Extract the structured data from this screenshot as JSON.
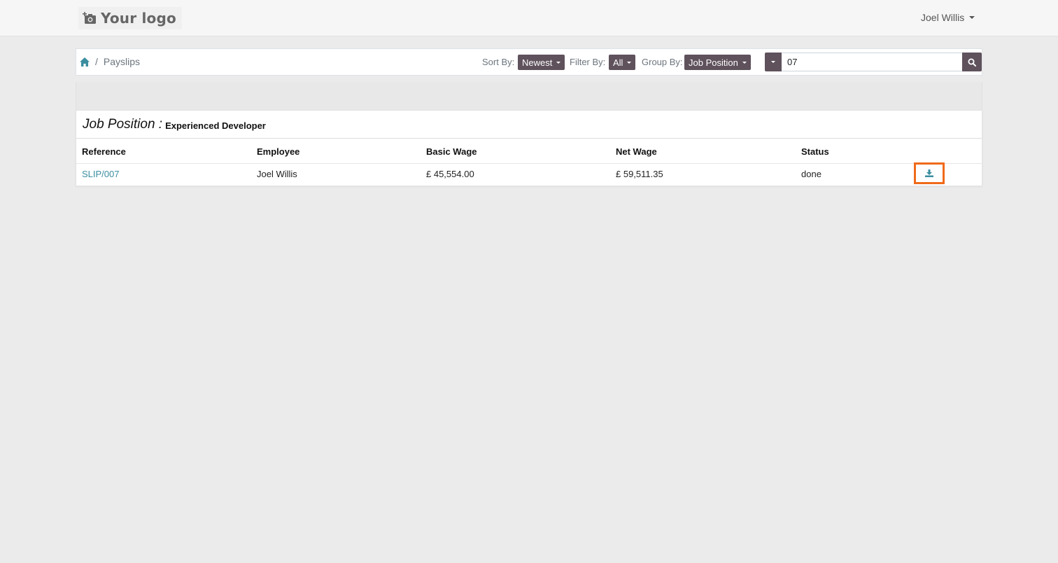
{
  "navbar": {
    "logo_text": "Your logo",
    "user_name": "Joel Willis"
  },
  "breadcrumb": {
    "current": "Payslips",
    "separator": "/"
  },
  "controls": {
    "sort_label": "Sort By:",
    "sort_value": "Newest",
    "filter_label": "Filter By:",
    "filter_value": "All",
    "group_label": "Group By:",
    "group_value": "Job Position",
    "search_value": "07"
  },
  "group": {
    "label": "Job Position :",
    "value": "Experienced Developer"
  },
  "table": {
    "columns": [
      "Reference",
      "Employee",
      "Basic Wage",
      "Net Wage",
      "Status"
    ],
    "rows": [
      {
        "reference": "SLIP/007",
        "employee": "Joel Willis",
        "basic_wage": "£ 45,554.00",
        "net_wage": "£ 59,511.35",
        "status": "done"
      }
    ]
  },
  "colors": {
    "accent_button": "#5f525c",
    "link": "#3b8ea0",
    "highlight": "#f06a1a"
  },
  "icons": {
    "logo": "camera-plus-icon",
    "home": "home-icon",
    "search": "search-icon",
    "download": "download-icon"
  }
}
